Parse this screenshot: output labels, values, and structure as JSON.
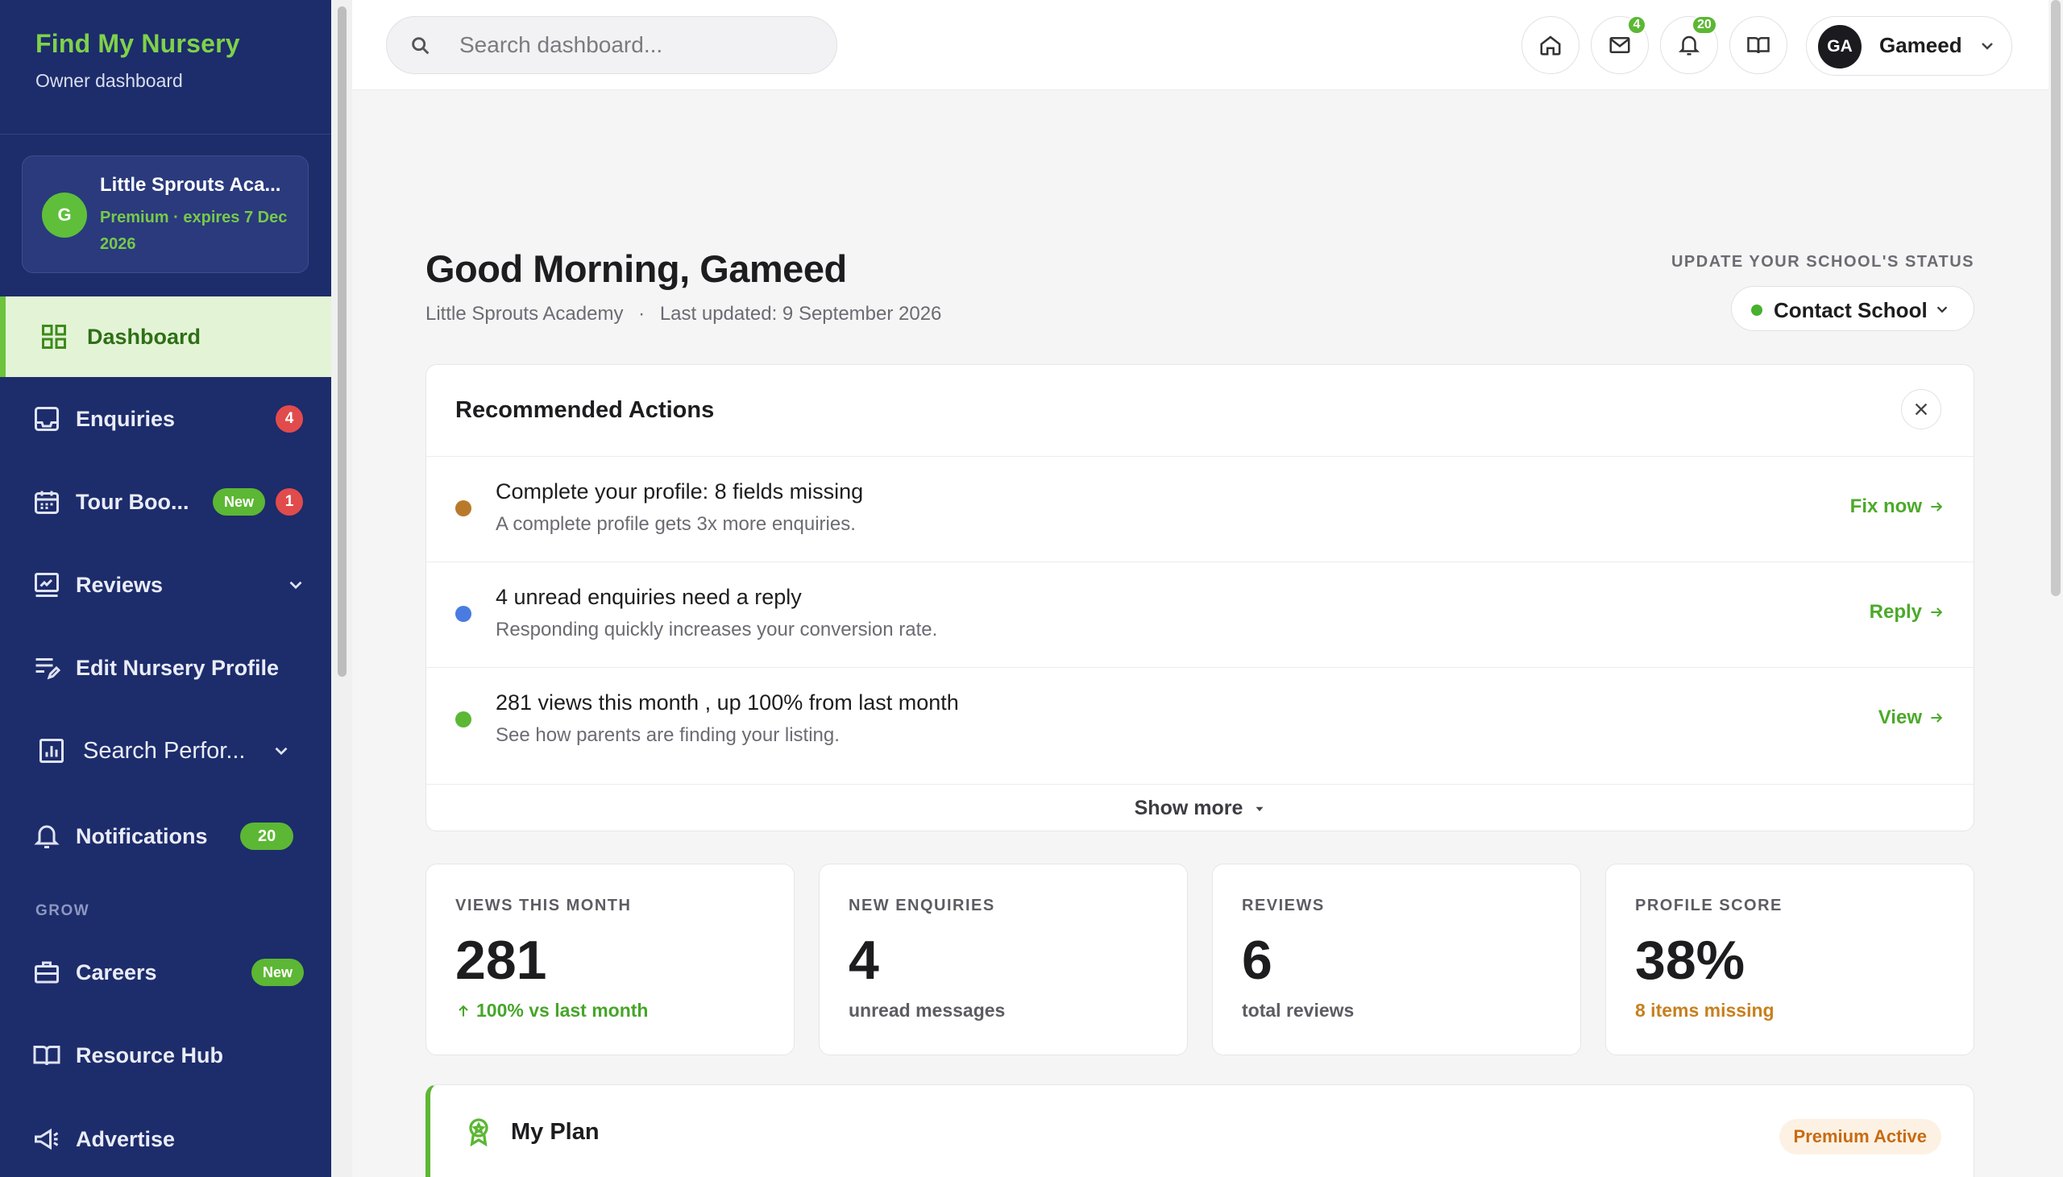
{
  "sidebar": {
    "brand_title": "Find My Nursery",
    "brand_subtitle": "Owner dashboard",
    "school": {
      "avatar_initial": "G",
      "name": "Little Sprouts Aca...",
      "plan": "Premium · expires 7 Dec 2026"
    },
    "items": {
      "dashboard": {
        "label": "Dashboard",
        "icon": "grid-icon"
      },
      "enquiries": {
        "label": "Enquiries",
        "icon": "inbox-icon",
        "badge": "4"
      },
      "tour_bookings": {
        "label": "Tour Boo...",
        "icon": "calendar-icon",
        "new_badge": "New",
        "badge": "1"
      },
      "reviews": {
        "label": "Reviews",
        "icon": "review-icon"
      },
      "edit_profile": {
        "label": "Edit Nursery Profile",
        "icon": "edit-list-icon"
      },
      "search_performance": {
        "label": "Search Perfor...",
        "icon": "chart-icon"
      },
      "notifications": {
        "label": "Notifications",
        "icon": "bell-icon",
        "badge": "20"
      },
      "careers": {
        "label": "Careers",
        "icon": "briefcase-icon",
        "new_badge": "New"
      },
      "resource_hub": {
        "label": "Resource Hub",
        "icon": "book-icon"
      },
      "advertise": {
        "label": "Advertise",
        "icon": "megaphone-icon"
      }
    },
    "section_grow": "GROW"
  },
  "header": {
    "search_placeholder": "Search dashboard...",
    "mail_badge": "4",
    "notifications_badge": "20",
    "user_initials": "GA",
    "user_name": "Gameed"
  },
  "main": {
    "greeting": "Good Morning, Gameed",
    "school_name": "Little Sprouts Academy",
    "separator": "·",
    "last_updated": "Last updated: 9 September 2026",
    "status_label": "UPDATE YOUR SCHOOL'S STATUS",
    "status_value": "Contact School",
    "recommended": {
      "title": "Recommended Actions",
      "items": [
        {
          "title": "Complete your profile: 8 fields missing",
          "subtitle": "A complete profile gets 3x more enquiries.",
          "action": "Fix now",
          "dot_color": "#b87a2a"
        },
        {
          "title": "4 unread enquiries need a reply",
          "subtitle": "Responding quickly increases your conversion rate.",
          "action": "Reply",
          "dot_color": "#4a7be0"
        },
        {
          "title": "281 views this month , up 100% from last month",
          "subtitle": "See how parents are finding your listing.",
          "action": "View",
          "dot_color": "#5cb734"
        }
      ],
      "show_more": "Show more"
    },
    "stats": [
      {
        "label": "VIEWS THIS MONTH",
        "value": "281",
        "foot": "100% vs last month",
        "foot_color": "#47a52a"
      },
      {
        "label": "NEW ENQUIRIES",
        "value": "4",
        "foot": "unread messages",
        "foot_color": "#5c5c63"
      },
      {
        "label": "REVIEWS",
        "value": "6",
        "foot": "total reviews",
        "foot_color": "#5c5c63"
      },
      {
        "label": "PROFILE SCORE",
        "value": "38%",
        "foot": "8 items missing",
        "foot_color": "#c7801e"
      }
    ],
    "plan": {
      "title": "My Plan",
      "badge": "Premium Active"
    }
  }
}
